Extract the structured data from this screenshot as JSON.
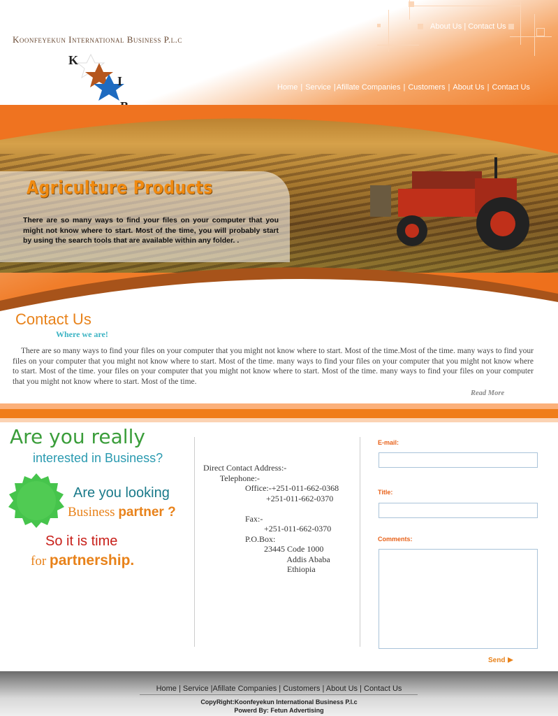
{
  "header": {
    "brand": "Koonfeyekun International Business P.l.c",
    "logo_letters": [
      "K",
      "I",
      "B"
    ],
    "top_nav": [
      "About Us",
      "Contact Us"
    ],
    "main_nav": [
      "Home",
      "Service",
      "Afillate Companies",
      "Customers",
      "About Us",
      "Contact Us"
    ]
  },
  "banner": {
    "headline": "Agriculture  Products",
    "text": "There are so many ways to find your files on your computer that you might not know where to start. Most of the time, you will probably start by using the search tools that are available within any folder.   ."
  },
  "contact": {
    "title": "Contact Us",
    "subtitle": "Where we are!",
    "body": "There are so many ways to find your files on your computer that you might not know where to start. Most of the time.Most of the time. many ways to find your files on your computer that you might not know where to start. Most of the time. many ways to find your files on your computer that you might not know where to start. Most of the time. your files on your computer that you might not know where to start. Most of the time. many ways to find your files on your computer that you might not know where to start. Most of the time.",
    "read_more": "Read More"
  },
  "promo": {
    "line1": "Are you really",
    "line2": "interested in Business?",
    "line3": "Are you looking",
    "line4a": "Business ",
    "line4b": "partner ?",
    "line5": "So it is time",
    "line6a": "for ",
    "line6b": "partnership."
  },
  "address": {
    "lines": [
      "Direct Contact Address:-",
      "        Telephone:-",
      "                    Office:-+251-011-662-0368",
      "                              +251-011-662-0370",
      "",
      "                    Fax:-",
      "                             +251-011-662-0370",
      "                    P.O.Box:",
      "                             23445 Code 1000",
      "                                        Addis Ababa",
      "                                        Ethiopia"
    ]
  },
  "form": {
    "email_label": "E-mail:",
    "title_label": "Title:",
    "comments_label": "Comments:",
    "send_label": "Send"
  },
  "footer": {
    "nav": [
      "Home",
      "Service",
      "Afillate Companies",
      "Customers",
      "About Us",
      "Contact Us"
    ],
    "copyright": "CopyRight:Koonfeyekun International Business P.l.c",
    "powered": "Powerd By: Fetun Advertising"
  },
  "colors": {
    "accent_orange": "#f07d1a",
    "headline_orange": "#f08a10",
    "teal": "#2a9ab0",
    "green": "#3a9d3a",
    "red": "#c8201a"
  }
}
